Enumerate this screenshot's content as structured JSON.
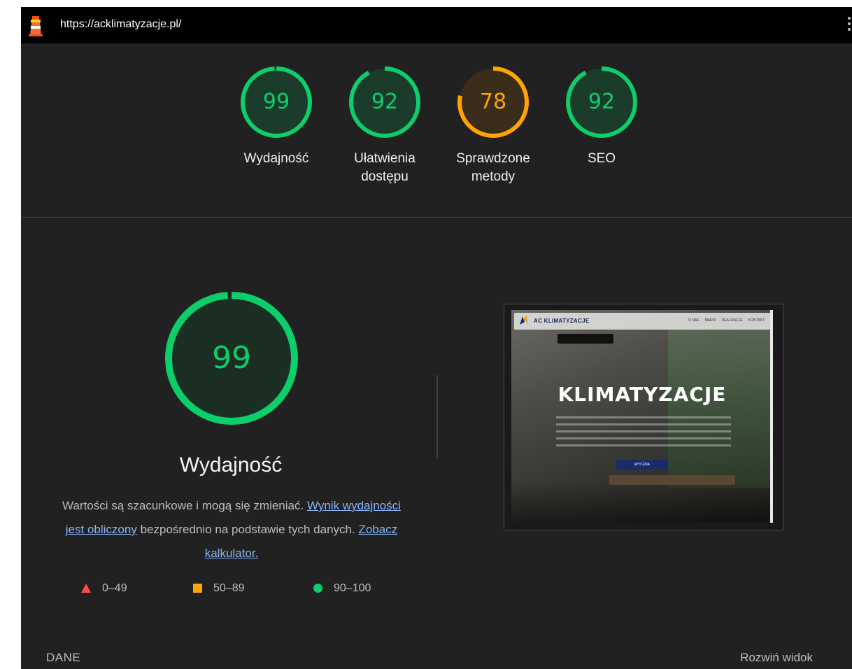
{
  "topbar": {
    "url": "https://acklimatyzacje.pl/"
  },
  "categories": [
    {
      "label": "Wydajność",
      "score": 99,
      "color": "#0cce6b",
      "fill": "#1b3b2b"
    },
    {
      "label": "Ułatwienia dostępu",
      "score": 92,
      "color": "#0cce6b",
      "fill": "#1b3b2b"
    },
    {
      "label": "Sprawdzone metody",
      "score": 78,
      "color": "#ffa400",
      "fill": "#3a2d1b"
    },
    {
      "label": "SEO",
      "score": 92,
      "color": "#0cce6b",
      "fill": "#1b3b2b"
    }
  ],
  "performance": {
    "score": 99,
    "title": "Wydajność",
    "desc_prefix": "Wartości są szacunkowe i mogą się zmieniać.",
    "desc_link1": "Wynik wydajności jest obliczony",
    "desc_middle": "bezpośrednio na podstawie tych danych.",
    "desc_link2": "Zobacz kalkulator."
  },
  "legend": {
    "fail": "0–49",
    "average": "50–89",
    "pass": "90–100"
  },
  "screenshot": {
    "brand": "AC KLIMATYZACJE",
    "nav_links": [
      "O NAS",
      "MARKI",
      "REALIZACJE",
      "KONTAKT"
    ],
    "headline": "KLIMATYZACJE",
    "button": "WYCENA"
  },
  "footer": {
    "left": "DANE",
    "right": "Rozwiń widok"
  },
  "colors": {
    "pass": "#0cce6b",
    "average": "#ffa400",
    "fail": "#ff4e42",
    "background": "#212121"
  }
}
